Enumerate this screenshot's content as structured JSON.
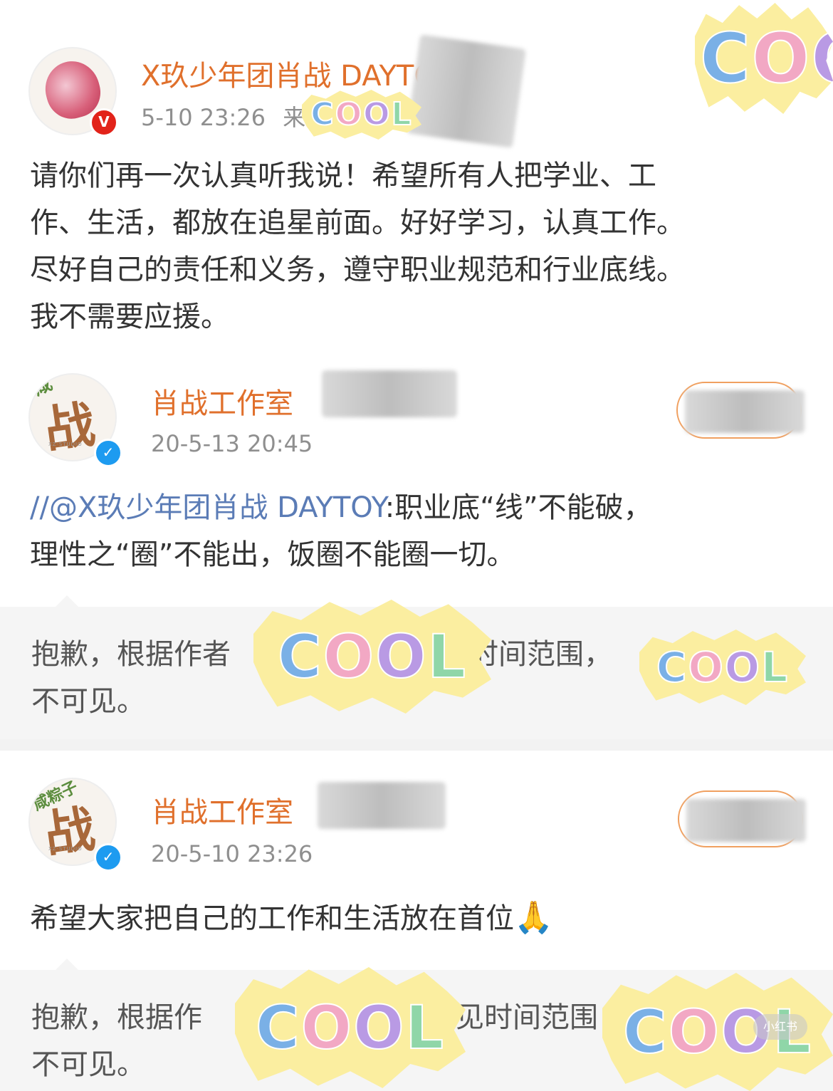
{
  "posts": [
    {
      "author": "X玖少年团肖战 DAYTOY",
      "time": "5-10 23:26",
      "source_prefix": "来",
      "verify_badge": "V",
      "text_lines": [
        "请你们再一次认真听我说！希望所有人把学业、工",
        "作、生活，都放在追星前面。好好学习，认真工作。",
        "尽好自己的责任和义务，遵守职业规范和行业底线。",
        "我不需要应援。"
      ]
    },
    {
      "author": "肖战工作室",
      "time": "20-5-13 20:45",
      "verify_badge": "✓",
      "avatar_char": "战",
      "avatar_studio_tag": "XZ·STUDIO",
      "repost_prefix": "//",
      "mention": "@X玖少年团肖战 DAYTOY",
      "text_line1_rest": ":职业底“线”不能破，",
      "text_line2": "理性之“圈”不能出，饭圈不能圈一切。",
      "notice_line1_a": "抱歉，根据作者",
      "notice_line1_b": "时间范围，",
      "notice_line2": "不可见。"
    },
    {
      "author": "肖战工作室",
      "time": "20-5-10 23:26",
      "verify_badge": "✓",
      "avatar_char": "战",
      "avatar_top_text": "咸粽子",
      "avatar_studio_tag": "XZ·STUDIO",
      "text": "希望大家把自己的工作和生活放在首位",
      "emoji": "🙏",
      "notice_line1_a": "抱歉，根据作",
      "notice_line1_b": "见时间范围",
      "notice_line2": "不可见。"
    }
  ],
  "watermark": "小红书",
  "colors": {
    "author_orange": "#e0702c",
    "mention_blue": "#5b7cb6",
    "verify_red": "#e2231a",
    "verify_blue": "#1d9bf0",
    "sticker_yellow": "#fbeea0",
    "cool_blue": "#7ab0e6",
    "cool_pink": "#f2a8c4",
    "cool_purple": "#b99ae4",
    "cool_green": "#8fd6a8"
  }
}
